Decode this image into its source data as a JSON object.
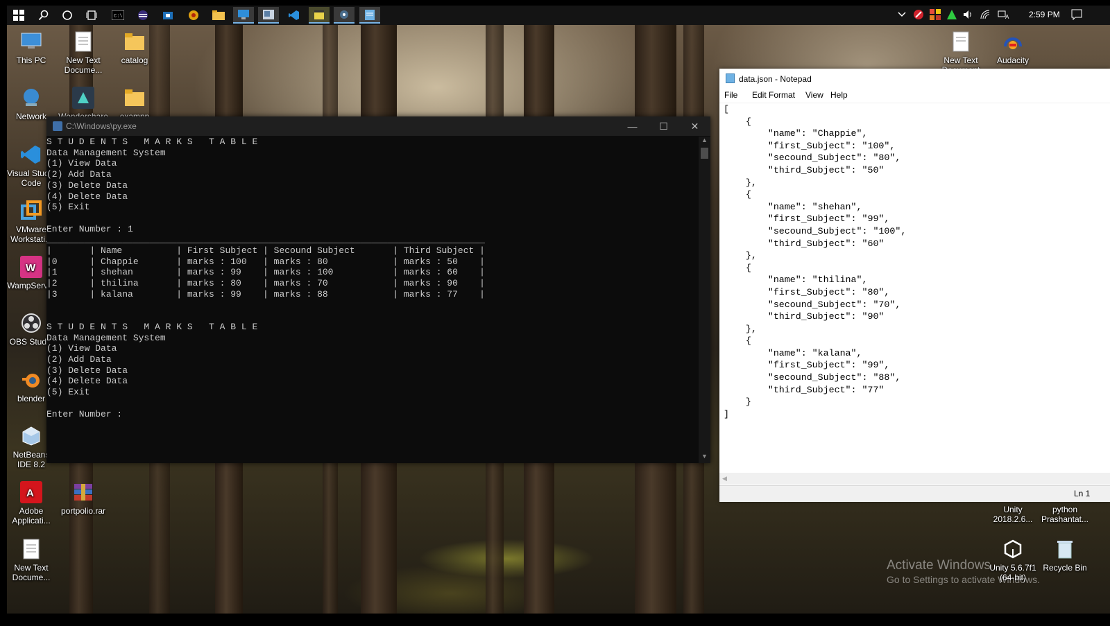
{
  "taskbar": {
    "start_icon": "windows-logo-icon",
    "pinned": [
      "search-icon",
      "cortana-icon",
      "task-view-icon",
      "cmd-icon",
      "eclipse-icon",
      "store-icon",
      "app-icon",
      "file-explorer-icon",
      "remote-desktop-icon",
      "app-icon",
      "vscode-icon",
      "clapper-icon",
      "wifi-tool-icon",
      "notepad-icon"
    ],
    "tray_icons": [
      "chevron-up-icon",
      "antivirus-icon",
      "colorful-app-icon",
      "green-triangle-icon",
      "volume-icon",
      "wifi-icon",
      "language-icon"
    ],
    "clock": "2:59 PM",
    "notification_icon": "notification-icon"
  },
  "desktop_left": [
    {
      "label": "This PC",
      "icon": "computer-icon"
    },
    {
      "label": "New Text Docume...",
      "icon": "text-file-icon"
    },
    {
      "label": "catalog",
      "icon": "folder-icon"
    },
    {
      "label": "Network",
      "icon": "network-icon"
    },
    {
      "label": "Wondershare",
      "icon": "wondershare-icon"
    },
    {
      "label": "examnp",
      "icon": "folder-icon"
    },
    {
      "label": "Visual Studio Code",
      "icon": "vscode-icon"
    },
    {
      "label": "VMware Workstati...",
      "icon": "vmware-icon"
    },
    {
      "label": "WampServer",
      "icon": "wampserver-icon"
    },
    {
      "label": "OBS Studio",
      "icon": "obs-icon"
    },
    {
      "label": "blender",
      "icon": "blender-icon"
    },
    {
      "label": "NetBeans IDE 8.2",
      "icon": "netbeans-icon"
    },
    {
      "label": "Adobe Applicati...",
      "icon": "adobe-icon"
    },
    {
      "label": "portpolio.rar",
      "icon": "winrar-icon"
    },
    {
      "label": "New Text Docume...",
      "icon": "text-file-icon"
    }
  ],
  "desktop_right": [
    {
      "label": "New Text Document",
      "icon": "text-file-icon"
    },
    {
      "label": "Audacity",
      "icon": "audacity-icon"
    },
    {
      "label": "Unity 2018.2.6...",
      "icon": "unity-icon"
    },
    {
      "label": "python Prashantat...",
      "icon": "python-icon"
    },
    {
      "label": "Unity 5.6.7f1 (64-bit)",
      "icon": "unity-icon"
    },
    {
      "label": "Recycle Bin",
      "icon": "recycle-bin-icon"
    }
  ],
  "console": {
    "title": "C:\\Windows\\py.exe",
    "minimize": "—",
    "maximize": "☐",
    "close": "✕",
    "content": "S T U D E N T S   M A R K S   T A B L E\nData Management System\n(1) View Data\n(2) Add Data\n(3) Delete Data\n(4) Delete Data\n(5) Exit\n\nEnter Number : 1\n_________________________________________________________________________________\n|       | Name          | First Subject | Secound Subject       | Third Subject |\n|0      | Chappie       | marks : 100   | marks : 80            | marks : 50    |\n|1      | shehan        | marks : 99    | marks : 100           | marks : 60    |\n|2      | thilina       | marks : 80    | marks : 70            | marks : 90    |\n|3      | kalana        | marks : 99    | marks : 88            | marks : 77    |\n\n\nS T U D E N T S   M A R K S   T A B L E\nData Management System\n(1) View Data\n(2) Add Data\n(3) Delete Data\n(4) Delete Data\n(5) Exit\n\nEnter Number :"
  },
  "notepad": {
    "title": "data.json - Notepad",
    "menu": [
      "File",
      "Edit",
      "Format",
      "View",
      "Help"
    ],
    "content": "[\n    {\n        \"name\": \"Chappie\",\n        \"first_Subject\": \"100\",\n        \"secound_Subject\": \"80\",\n        \"third_Subject\": \"50\"\n    },\n    {\n        \"name\": \"shehan\",\n        \"first_Subject\": \"99\",\n        \"secound_Subject\": \"100\",\n        \"third_Subject\": \"60\"\n    },\n    {\n        \"name\": \"thilina\",\n        \"first_Subject\": \"80\",\n        \"secound_Subject\": \"70\",\n        \"third_Subject\": \"90\"\n    },\n    {\n        \"name\": \"kalana\",\n        \"first_Subject\": \"99\",\n        \"secound_Subject\": \"88\",\n        \"third_Subject\": \"77\"\n    }\n]",
    "status": "Ln 1"
  },
  "watermark": {
    "line1": "Activate Windows",
    "line2": "Go to Settings to activate Windows."
  }
}
